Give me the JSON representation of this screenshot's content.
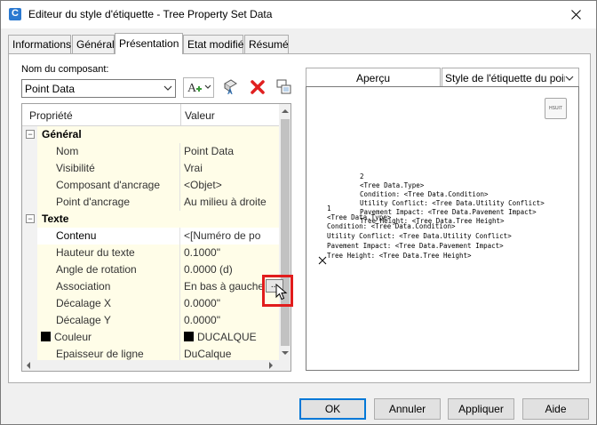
{
  "window": {
    "title": "Editeur du style d'étiquette - Tree Property Set Data",
    "app_icon_letter": "C"
  },
  "tabs": [
    {
      "label": "Informations"
    },
    {
      "label": "Général"
    },
    {
      "label": "Présentation",
      "active": true
    },
    {
      "label": "Etat modifié"
    },
    {
      "label": "Résumé"
    }
  ],
  "component": {
    "label": "Nom du composant:",
    "selected": "Point Data"
  },
  "toolbar": {
    "icons": [
      "add-text-component-icon",
      "copy-component-icon",
      "delete-component-icon",
      "component-draw-order-icon"
    ]
  },
  "grid": {
    "headers": {
      "property": "Propriété",
      "value": "Valeur"
    },
    "rows": [
      {
        "type": "category",
        "toggle": "−",
        "name": "Général"
      },
      {
        "name": "Nom",
        "value": "Point Data"
      },
      {
        "name": "Visibilité",
        "value": "Vrai"
      },
      {
        "name": "Composant d'ancrage",
        "value": "<Objet>"
      },
      {
        "name": "Point d'ancrage",
        "value": "Au milieu à droite"
      },
      {
        "type": "category",
        "toggle": "−",
        "name": "Texte"
      },
      {
        "name": "Contenu",
        "value": "<[Numéro de po",
        "selected": true
      },
      {
        "name": "Hauteur du texte",
        "value": "0.1000\""
      },
      {
        "name": "Angle de rotation",
        "value": "0.0000 (d)"
      },
      {
        "name": "Association",
        "value": "En bas à gauche"
      },
      {
        "name": "Décalage X",
        "value": "0.0000\""
      },
      {
        "name": "Décalage Y",
        "value": "0.0000\""
      },
      {
        "name": "Couleur",
        "value": "DUCALQUE",
        "swatch": "#000000"
      },
      {
        "name": "Epaisseur de ligne",
        "value": "DuCalque"
      }
    ],
    "ellipsis_label": "..."
  },
  "preview": {
    "tab_label": "Aperçu",
    "style_select": "Style de l'étiquette du point",
    "badge": "HSUIT",
    "lines": [
      "2",
      "<Tree Data.Type>",
      "Condition: <Tree Data.Condition>",
      "Utility Conflict: <Tree Data.Utility Conflict>",
      "Pavement Impact: <Tree Data.Pavement Impact>",
      "Tree Height: <Tree Data.Tree Height>",
      "1",
      "<Tree Data.Type>",
      "Condition: <Tree Data.Condition>",
      "Utility Conflict: <Tree Data.Utility Conflict>",
      "Pavement Impact: <Tree Data.Pavement Impact>",
      "Tree Height: <Tree Data.Tree Height>"
    ]
  },
  "buttons": {
    "ok": "OK",
    "cancel": "Annuler",
    "apply": "Appliquer",
    "help": "Aide"
  },
  "colors": {
    "highlight_box": "#e11c1c",
    "grid_row_bg": "#fffde8",
    "delete_icon": "#e02020"
  }
}
